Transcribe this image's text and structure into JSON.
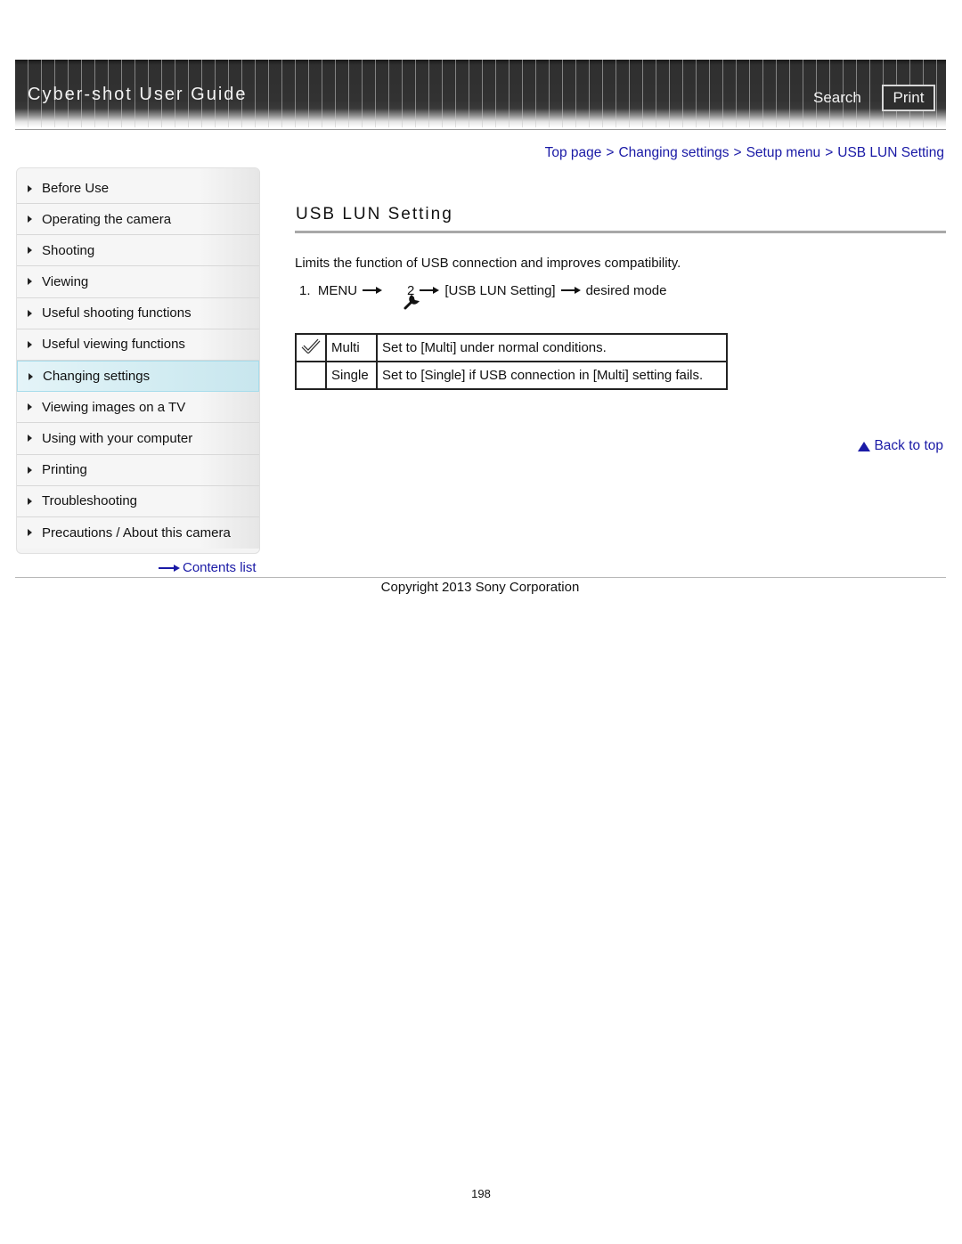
{
  "header": {
    "app_title": "Cyber-shot User Guide",
    "search_label": "Search",
    "print_label": "Print"
  },
  "breadcrumb": [
    {
      "label": "Top page"
    },
    {
      "label": "Changing settings"
    },
    {
      "label": "Setup menu"
    },
    {
      "label": "USB LUN Setting"
    }
  ],
  "breadcrumb_separator": ">",
  "sidebar": {
    "items": [
      {
        "label": "Before Use",
        "active": false
      },
      {
        "label": "Operating the camera",
        "active": false
      },
      {
        "label": "Shooting",
        "active": false
      },
      {
        "label": "Viewing",
        "active": false
      },
      {
        "label": "Useful shooting functions",
        "active": false
      },
      {
        "label": "Useful viewing functions",
        "active": false
      },
      {
        "label": "Changing settings",
        "active": true
      },
      {
        "label": "Viewing images on a TV",
        "active": false
      },
      {
        "label": "Using with your computer",
        "active": false
      },
      {
        "label": "Printing",
        "active": false
      },
      {
        "label": "Troubleshooting",
        "active": false
      },
      {
        "label": "Precautions / About this camera",
        "active": false
      }
    ],
    "contents_list_label": "Contents list"
  },
  "main": {
    "title": "USB LUN Setting",
    "intro": "Limits the function of USB connection and improves compatibility.",
    "step": {
      "number": "1.",
      "menu": "MENU",
      "icon": "wrench-icon",
      "page": "2",
      "item": "[USB LUN Setting]",
      "target": "desired mode"
    },
    "options": [
      {
        "default": true,
        "name": "Multi",
        "description": "Set to [Multi] under normal conditions."
      },
      {
        "default": false,
        "name": "Single",
        "description": "Set to [Single] if USB connection in [Multi] setting fails."
      }
    ],
    "back_to_top_label": "Back to top"
  },
  "footer": {
    "copyright": "Copyright 2013 Sony Corporation",
    "page_number": "198"
  },
  "colors": {
    "link": "#1a1aa6",
    "active_nav": "#d2ecf2",
    "header_bg": "#323232"
  }
}
